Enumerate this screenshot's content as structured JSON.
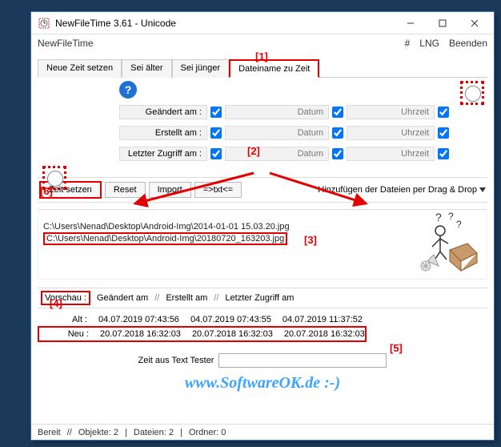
{
  "window": {
    "title": "NewFileTime 3.61 - Unicode",
    "menu": {
      "appname": "NewFileTime",
      "hash": "#",
      "lng": "LNG",
      "exit": "Beenden"
    }
  },
  "tabs": [
    "Neue Zeit setzen",
    "Sei älter",
    "Sei jünger",
    "Dateiname zu Zeit"
  ],
  "date_rows": [
    {
      "label": "Geändert am :",
      "datum": "Datum",
      "uhrzeit": "Uhrzeit"
    },
    {
      "label": "Erstellt am :",
      "datum": "Datum",
      "uhrzeit": "Uhrzeit"
    },
    {
      "label": "Letzter Zugriff am :",
      "datum": "Datum",
      "uhrzeit": "Uhrzeit"
    }
  ],
  "actions": {
    "set_time": "Zeit setzen",
    "reset": "Reset",
    "import": "Import",
    "txt": "=>txt<=",
    "dragdrop": "Hinzufügen der Dateien per Drag & Drop"
  },
  "files": [
    "C:\\Users\\Nenad\\Desktop\\Android-Img\\2014-01-01 15.03.20.jpg",
    "C:\\Users\\Nenad\\Desktop\\Android-Img\\20180720_163203.jpg"
  ],
  "preview": {
    "label": "Vorschau :",
    "headers": [
      "Geändert am",
      "Erstellt am",
      "Letzter Zugriff am"
    ],
    "sep": "//",
    "alt_label": "Alt :",
    "alt": [
      "04.07.2019 07:43:56",
      "04.07.2019 07:43:55",
      "04.07.2019 11:37:52"
    ],
    "neu_label": "Neu :",
    "neu": [
      "20.07.2018 16:32:03",
      "20.07.2018 16:32:03",
      "20.07.2018 16:32:03"
    ]
  },
  "tester": {
    "label": "Zeit aus Text Tester",
    "value": ""
  },
  "watermark": "www.SoftwareOK.de :-)",
  "status": {
    "bereit": "Bereit",
    "objekte": "Objekte: 2",
    "dateien": "Dateien: 2",
    "ordner": "Ordner: 0",
    "sep": "//"
  },
  "callouts": {
    "c1": "[1]",
    "c2": "[2]",
    "c3": "[3]",
    "c4": "[4]",
    "c5": "[5]",
    "c6": "[6]"
  }
}
